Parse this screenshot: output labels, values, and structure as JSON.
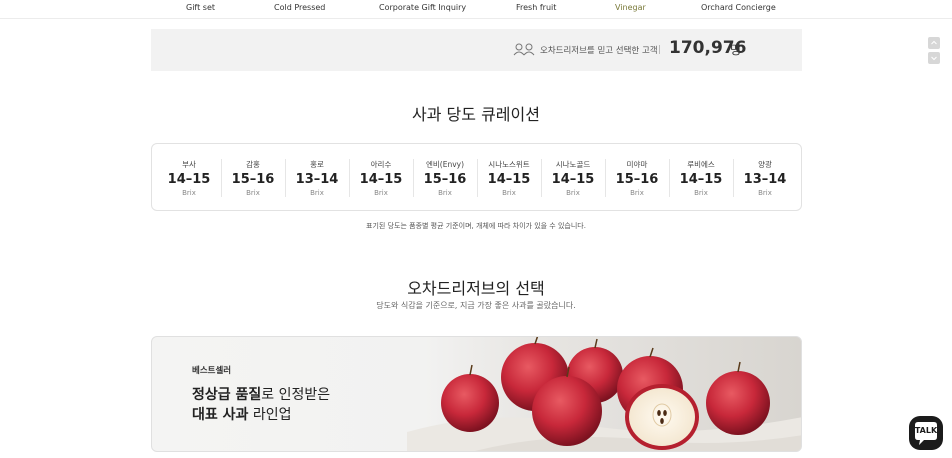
{
  "nav": {
    "items": [
      {
        "label": "Gift set"
      },
      {
        "label": "Cold Pressed"
      },
      {
        "label": "Corporate Gift Inquiry"
      },
      {
        "label": "Fresh fruit"
      },
      {
        "label": "Vinegar",
        "active": true
      },
      {
        "label": "Orchard Concierge"
      }
    ]
  },
  "counter": {
    "icon": "people-icon",
    "label": "오차드리저브를 믿고 선택한 고객",
    "value": "170,976",
    "unit": "명"
  },
  "sweetness": {
    "title": "사과 당도 큐레이션",
    "items": [
      {
        "name": "부사",
        "range": "14–15",
        "unit": "Brix"
      },
      {
        "name": "감홍",
        "range": "15–16",
        "unit": "Brix"
      },
      {
        "name": "홍로",
        "range": "13–14",
        "unit": "Brix"
      },
      {
        "name": "아리수",
        "range": "14–15",
        "unit": "Brix"
      },
      {
        "name": "엔비(Envy)",
        "range": "15–16",
        "unit": "Brix"
      },
      {
        "name": "시나노스위트",
        "range": "14–15",
        "unit": "Brix"
      },
      {
        "name": "시나노골드",
        "range": "14–15",
        "unit": "Brix"
      },
      {
        "name": "미야마",
        "range": "15–16",
        "unit": "Brix"
      },
      {
        "name": "루비에스",
        "range": "14–15",
        "unit": "Brix"
      },
      {
        "name": "양광",
        "range": "13–14",
        "unit": "Brix"
      }
    ],
    "note": "표기된 당도는 품종별 평균 기준이며, 개체에 따라 차이가 있을 수 있습니다."
  },
  "choice": {
    "title": "오차드리저브의 선택",
    "subtitle": "당도와 식감을 기준으로, 지금 가장 좋은 사과를 골랐습니다."
  },
  "banner": {
    "tag": "베스트셀러",
    "line1_bold": "정상급 품질",
    "line1_rest": "로 인정받은",
    "line2_bold": "대표 사과",
    "line2_rest": " 라인업"
  },
  "chat": {
    "label": "TALK",
    "icon": "chat-bubble-icon"
  },
  "colors": {
    "nav_active": "#7a7a3a",
    "counter_bg": "#f2f2f2",
    "apple_red": "#c8283a"
  }
}
